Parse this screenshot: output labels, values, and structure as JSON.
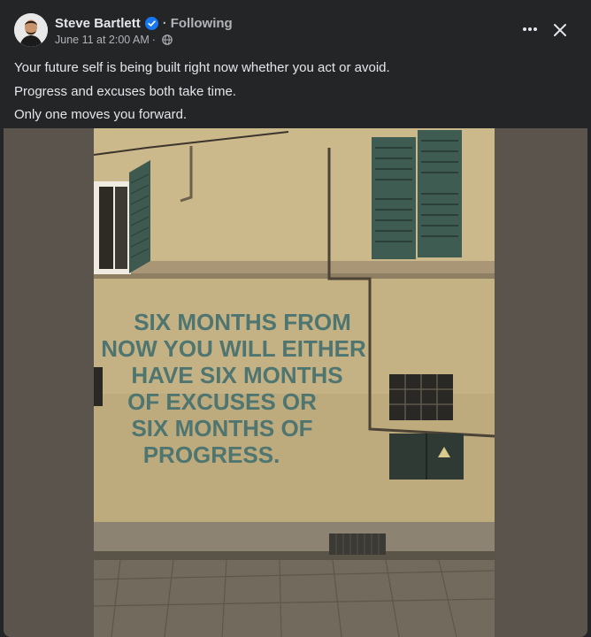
{
  "post": {
    "author": "Steve Bartlett",
    "separator": "·",
    "follow_status": "Following",
    "timestamp": "June 11 at 2:00 AM",
    "meta_separator": "·",
    "body_lines": [
      "Your future self is being built right now whether you act or avoid.",
      "Progress and excuses both take time.",
      "Only one moves you forward."
    ]
  },
  "photo": {
    "wall_text": [
      "SIX MONTHS FROM",
      "NOW YOU WILL EITHER",
      "HAVE SIX MONTHS",
      "OF EXCUSES OR",
      "SIX MONTHS OF",
      "PROGRESS."
    ]
  },
  "icons": {
    "verified": "verified-badge-icon",
    "audience": "globe-icon",
    "more": "more-horizontal-icon",
    "close": "close-icon"
  },
  "colors": {
    "background": "#242526",
    "primary_text": "#e4e6eb",
    "secondary_text": "#b0b3b8",
    "verified_blue": "#1877f2",
    "wall_text": "#4f7570"
  }
}
